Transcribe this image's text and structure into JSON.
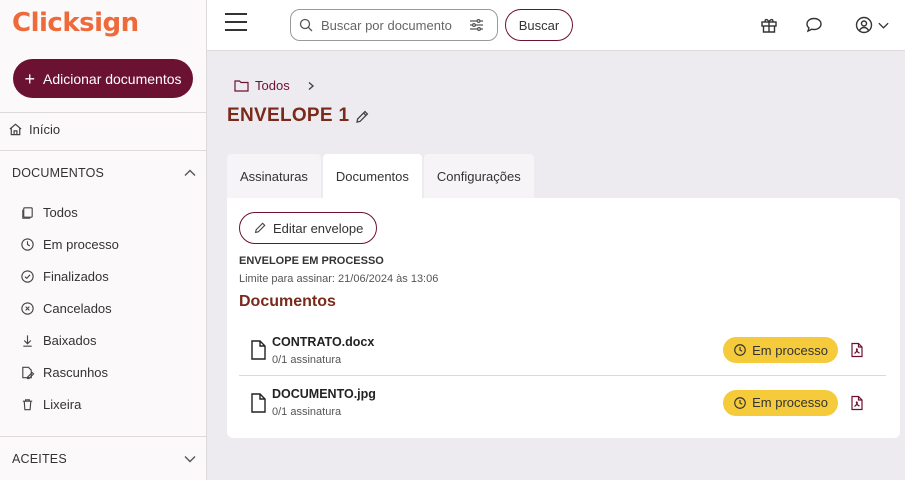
{
  "brand": {
    "name": "Clicksign",
    "color": "#ef6a3a",
    "primary": "#6b1232"
  },
  "sidebar": {
    "add_button": "Adicionar documentos",
    "home": "Início",
    "documents_section": "DOCUMENTOS",
    "items": [
      {
        "label": "Todos",
        "icon": "folder-icon"
      },
      {
        "label": "Em processo",
        "icon": "clock-icon"
      },
      {
        "label": "Finalizados",
        "icon": "check-circle-icon"
      },
      {
        "label": "Cancelados",
        "icon": "x-circle-icon"
      },
      {
        "label": "Baixados",
        "icon": "download-icon"
      },
      {
        "label": "Rascunhos",
        "icon": "draft-icon"
      },
      {
        "label": "Lixeira",
        "icon": "trash-icon"
      }
    ],
    "aceites_section": "ACEITES"
  },
  "topbar": {
    "search_placeholder": "Buscar por documento",
    "search_button": "Buscar"
  },
  "breadcrumb": {
    "root": "Todos"
  },
  "envelope": {
    "title": "ENVELOPE 1",
    "tabs": [
      "Assinaturas",
      "Documentos",
      "Configurações"
    ],
    "active_tab": "Documentos",
    "edit_button": "Editar envelope",
    "status": "ENVELOPE EM PROCESSO",
    "limit": "Limite para assinar: 21/06/2024 às 13:06",
    "documents_heading": "Documentos",
    "documents": [
      {
        "name": "CONTRATO.docx",
        "signatures": "0/1 assinatura",
        "status": "Em processo"
      },
      {
        "name": "DOCUMENTO.jpg",
        "signatures": "0/1 assinatura",
        "status": "Em processo"
      }
    ],
    "badge_color": "#f5cb3c"
  }
}
